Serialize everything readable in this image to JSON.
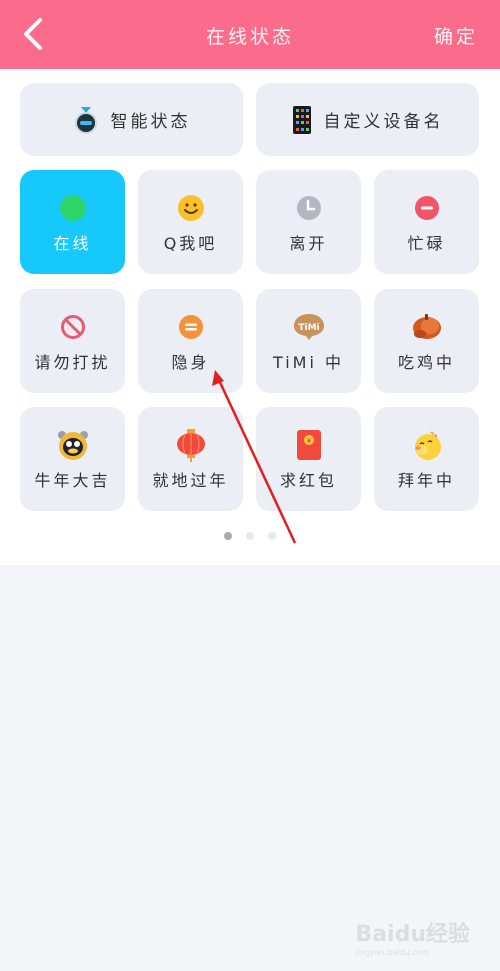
{
  "header": {
    "title": "在线状态",
    "confirm_label": "确定",
    "back_icon": "chevron-left-icon",
    "background": "#fb6b8b"
  },
  "top_buttons": [
    {
      "label": "智能状态",
      "icon": "robot-icon"
    },
    {
      "label": "自定义设备名",
      "icon": "phone-icon"
    }
  ],
  "statuses": [
    {
      "label": "在线",
      "icon": "online-dot-icon",
      "selected": true
    },
    {
      "label": "Q我吧",
      "icon": "smile-icon",
      "selected": false
    },
    {
      "label": "离开",
      "icon": "clock-icon",
      "selected": false
    },
    {
      "label": "忙碌",
      "icon": "busy-icon",
      "selected": false
    },
    {
      "label": "请勿打扰",
      "icon": "do-not-disturb-icon",
      "selected": false
    },
    {
      "label": "隐身",
      "icon": "invisible-icon",
      "selected": false
    },
    {
      "label": "TiMi 中",
      "icon": "timi-icon",
      "icon_text": "TiMi",
      "selected": false
    },
    {
      "label": "吃鸡中",
      "icon": "chicken-icon",
      "selected": false
    },
    {
      "label": "牛年大吉",
      "icon": "ox-penguin-icon",
      "selected": false
    },
    {
      "label": "就地过年",
      "icon": "lantern-icon",
      "selected": false
    },
    {
      "label": "求红包",
      "icon": "red-envelope-icon",
      "selected": false
    },
    {
      "label": "拜年中",
      "icon": "chick-icon",
      "selected": false
    }
  ],
  "pagination": {
    "pages": 3,
    "current": 1
  },
  "colors": {
    "selected_tile": "#16c8fb",
    "tile": "#ebeef4",
    "annotation_arrow": "#e02020"
  },
  "watermark": {
    "text": "Baidu经验",
    "sub": "jingyan.baidu.com"
  }
}
